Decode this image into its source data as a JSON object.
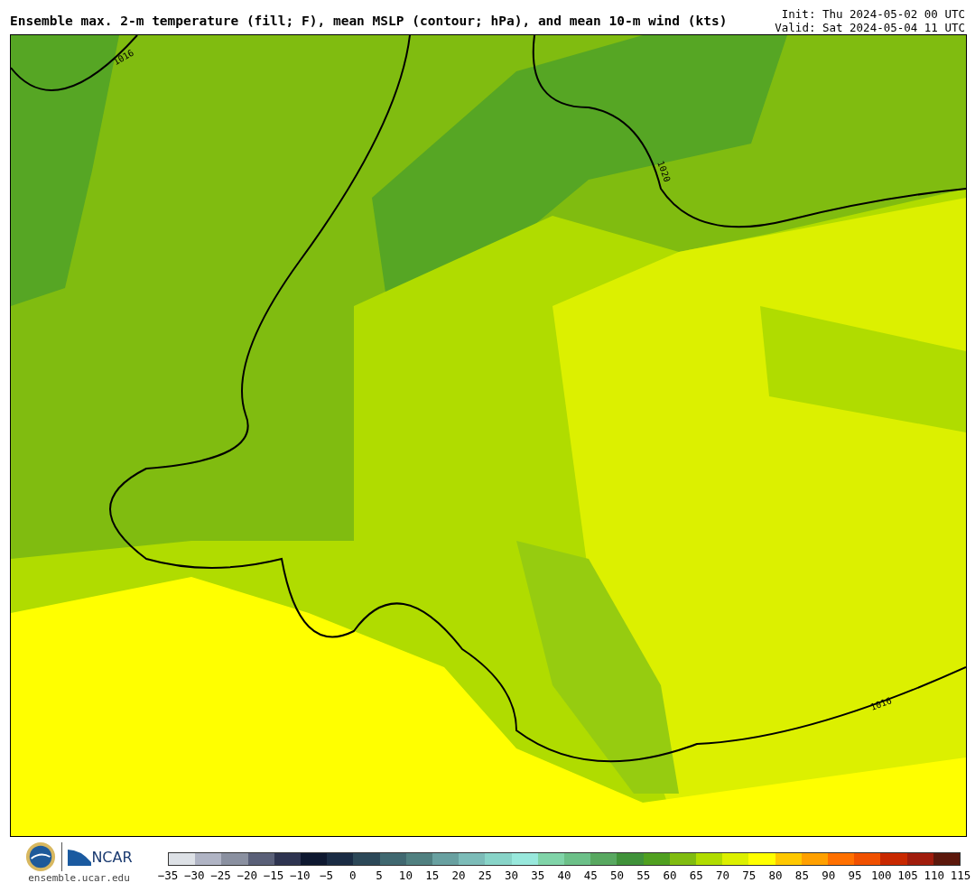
{
  "header": {
    "title": "Ensemble max. 2-m temperature (fill; F), mean MSLP (contour; hPa), and mean 10-m wind (kts)",
    "init": "Init: Thu 2024-05-02 00 UTC",
    "valid": "Valid: Sat 2024-05-04 11 UTC"
  },
  "map": {
    "contour_labels": [
      "1016",
      "1020",
      "1016"
    ]
  },
  "footer": {
    "site": "ensemble.ucar.edu",
    "org": "NCAR"
  },
  "colorbar": {
    "bins": [
      {
        "color": "#dde1e6"
      },
      {
        "color": "#b0b4c4"
      },
      {
        "color": "#8a90a0"
      },
      {
        "color": "#5a6078"
      },
      {
        "color": "#2e3450"
      },
      {
        "color": "#0e1830"
      },
      {
        "color": "#1a2c44"
      },
      {
        "color": "#2c4858"
      },
      {
        "color": "#406870"
      },
      {
        "color": "#508080"
      },
      {
        "color": "#68a0a0"
      },
      {
        "color": "#7cbcb8"
      },
      {
        "color": "#88d4c8"
      },
      {
        "color": "#98e8dc"
      },
      {
        "color": "#80d4a8"
      },
      {
        "color": "#6cc088"
      },
      {
        "color": "#58a860"
      },
      {
        "color": "#40923a"
      },
      {
        "color": "#50a020"
      },
      {
        "color": "#80bc10"
      },
      {
        "color": "#b0dc00"
      },
      {
        "color": "#dcf000"
      },
      {
        "color": "#ffff00"
      },
      {
        "color": "#ffc800"
      },
      {
        "color": "#ffa000"
      },
      {
        "color": "#ff7000"
      },
      {
        "color": "#f05000"
      },
      {
        "color": "#c82800"
      },
      {
        "color": "#a01c0c"
      },
      {
        "color": "#5c180c"
      }
    ],
    "ticks": [
      "−35",
      "−30",
      "−25",
      "−20",
      "−15",
      "−10",
      "−5",
      "0",
      "5",
      "10",
      "15",
      "20",
      "25",
      "30",
      "35",
      "40",
      "45",
      "50",
      "55",
      "60",
      "65",
      "70",
      "75",
      "80",
      "85",
      "90",
      "95",
      "100",
      "105",
      "110",
      "115"
    ]
  }
}
